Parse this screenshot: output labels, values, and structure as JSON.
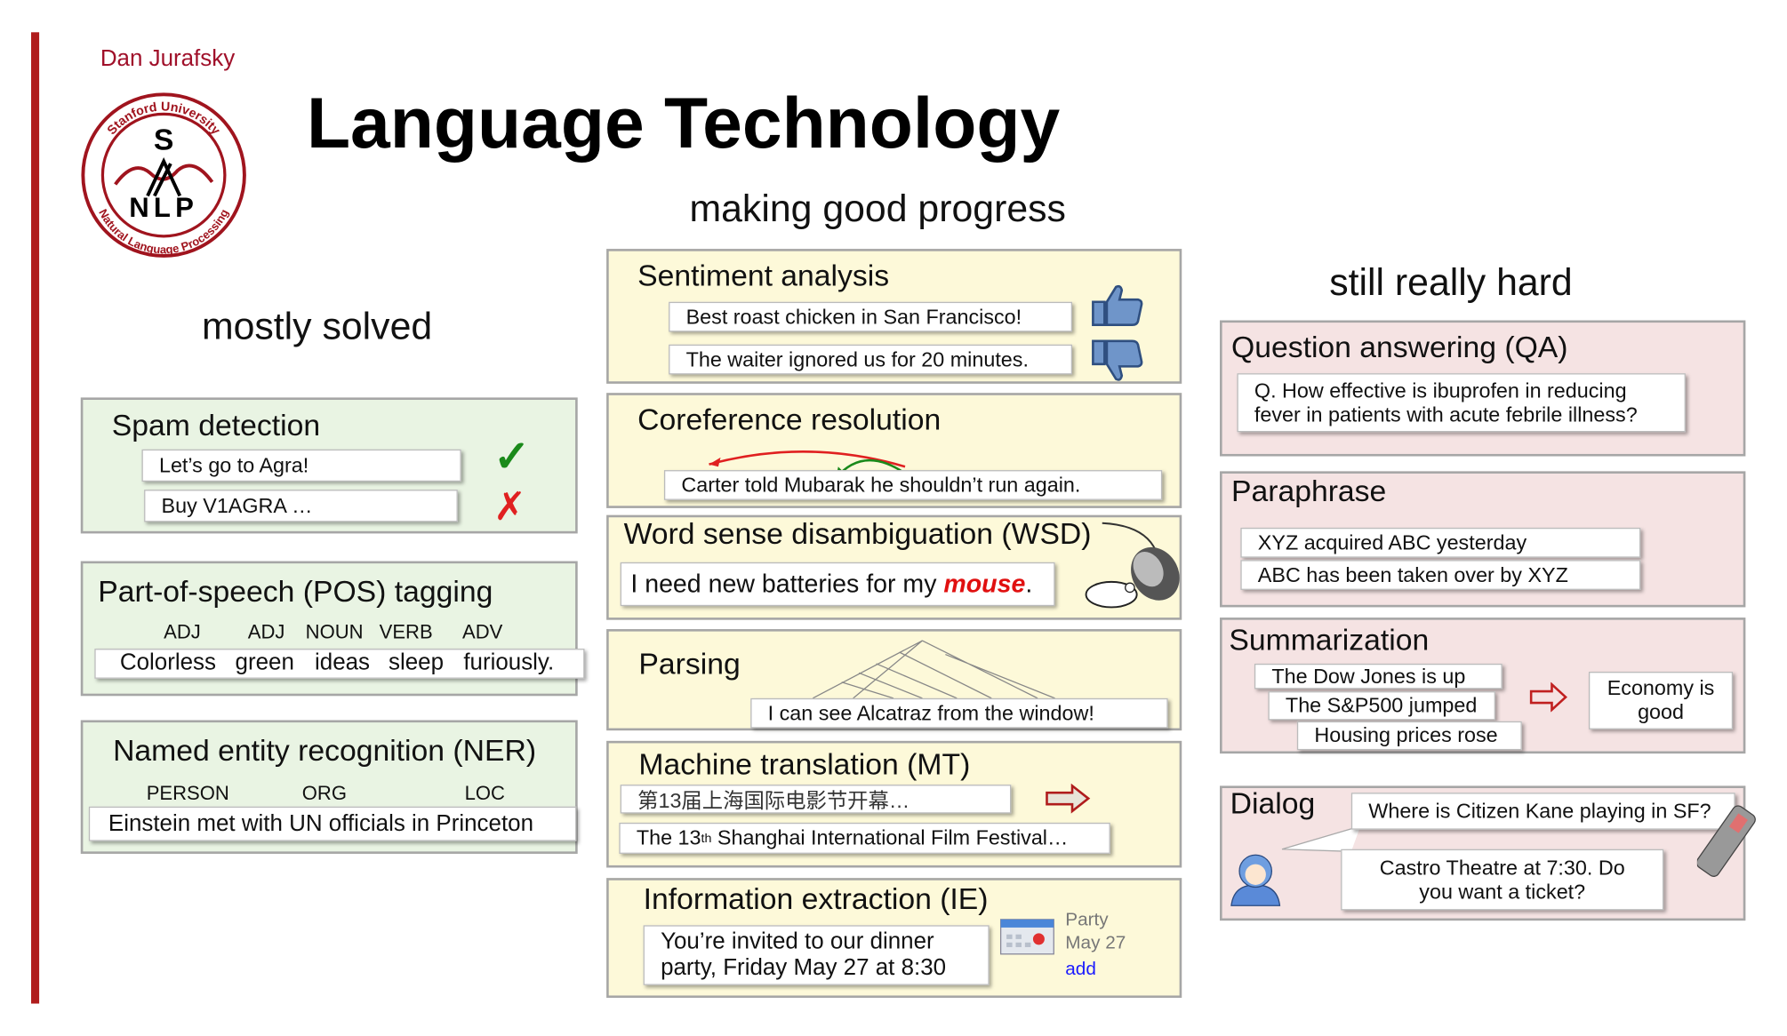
{
  "author": "Dan Jurafsky",
  "logo": {
    "top_text": "Stanford University",
    "letters": "S NLP",
    "bottom_text": "Natural Language Processing"
  },
  "title": "Language Technology",
  "columns": {
    "mostly_solved": {
      "heading": "mostly solved",
      "spam": {
        "title": "Spam detection",
        "examples": [
          "Let’s go to Agra!",
          "Buy V1AGRA …"
        ],
        "icons": [
          "check-icon",
          "cross-icon"
        ],
        "colors": {
          "check": "#1a8a1a",
          "cross": "#e02020"
        }
      },
      "pos": {
        "title": "Part-of-speech (POS) tagging",
        "tags": [
          "ADJ",
          "ADJ",
          "NOUN",
          "VERB",
          "ADV"
        ],
        "words": [
          "Colorless",
          "green",
          "ideas",
          "sleep",
          "furiously."
        ]
      },
      "ner": {
        "title": "Named entity recognition (NER)",
        "tags": [
          "PERSON",
          "ORG",
          "LOC"
        ],
        "sentence": "Einstein met with UN officials in Princeton"
      }
    },
    "making_good_progress": {
      "heading": "making good progress",
      "sentiment": {
        "title": "Sentiment analysis",
        "examples": [
          "Best roast chicken in San Francisco!",
          "The waiter ignored us for 20 minutes."
        ]
      },
      "coref": {
        "title": "Coreference resolution",
        "sentence": "Carter told Mubarak he shouldn’t run again."
      },
      "wsd": {
        "title": "Word sense disambiguation (WSD)",
        "sentence_before": "I need new batteries for my ",
        "highlight": "mouse",
        "sentence_after": "."
      },
      "parsing": {
        "title": "Parsing",
        "sentence": "I can see Alcatraz from the window!"
      },
      "mt": {
        "title": "Machine translation (MT)",
        "source": "第13届上海国际电影节开幕…",
        "target_pre": "The 13",
        "target_sup": "th",
        "target_post": " Shanghai International Film Festival…"
      },
      "ie": {
        "title": "Information extraction (IE)",
        "line1": "You’re invited to our dinner",
        "line2": "party, Friday May 27 at 8:30",
        "event": "Party",
        "date": "May 27",
        "add": "add"
      }
    },
    "still_really_hard": {
      "heading": "still really hard",
      "qa": {
        "title": "Question answering (QA)",
        "line1": "Q. How effective is ibuprofen in reducing",
        "line2": "fever in patients with acute febrile illness?"
      },
      "paraphrase": {
        "title": "Paraphrase",
        "examples": [
          "XYZ acquired ABC yesterday",
          "ABC has been taken over by XYZ"
        ]
      },
      "summarization": {
        "title": "Summarization",
        "inputs": [
          "The Dow Jones is up",
          "The S&P500 jumped",
          "Housing prices rose"
        ],
        "out1": "Economy is",
        "out2": "good"
      },
      "dialog": {
        "title": "Dialog",
        "question": "Where is Citizen Kane playing in SF?",
        "answer1": "Castro Theatre at 7:30. Do",
        "answer2": "you want a ticket?"
      }
    }
  },
  "colors": {
    "accent_red": "#b01c1c",
    "green_panel": "#e9f4e3",
    "yellow_panel": "#fdf9d9",
    "pink_panel": "#f5e3e3",
    "link_blue": "#1a1aff"
  }
}
